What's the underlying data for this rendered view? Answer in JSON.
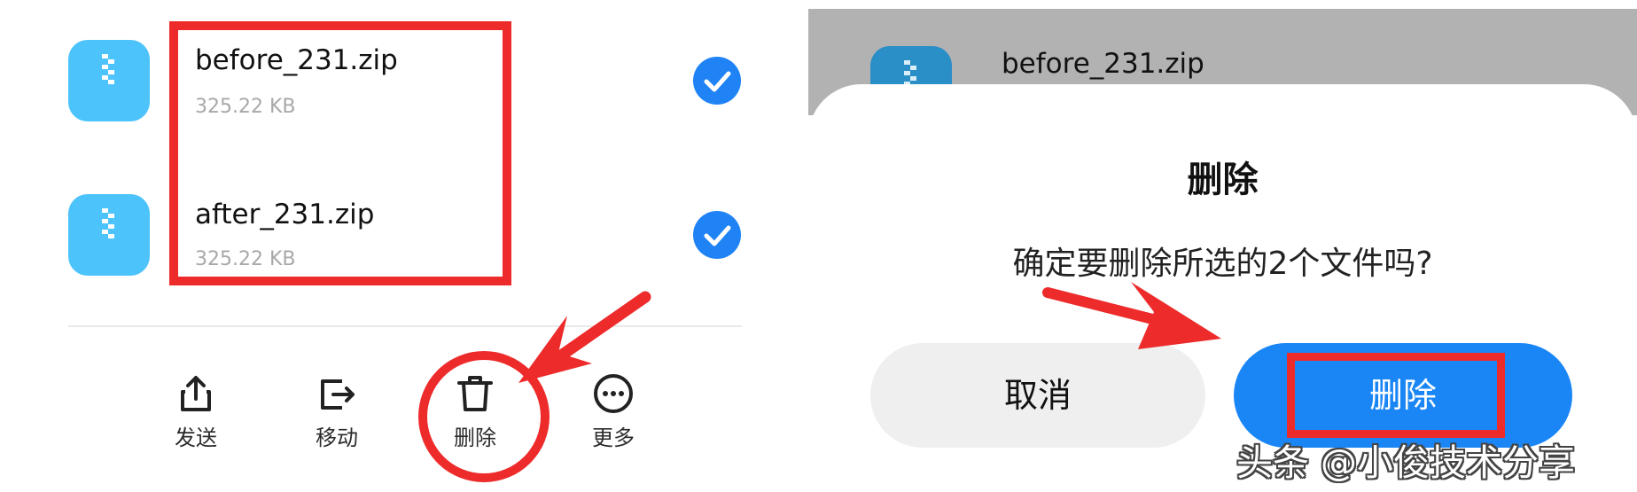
{
  "left_panel": {
    "files": [
      {
        "name": "before_231.zip",
        "size": "325.22 KB",
        "checked": true
      },
      {
        "name": "after_231.zip",
        "size": "325.22 KB",
        "checked": true
      }
    ],
    "toolbar": [
      {
        "label": "发送",
        "icon": "share-icon"
      },
      {
        "label": "移动",
        "icon": "move-icon"
      },
      {
        "label": "删除",
        "icon": "trash-icon"
      },
      {
        "label": "更多",
        "icon": "more-icon"
      }
    ]
  },
  "right_panel": {
    "background_file": {
      "name": "before_231.zip"
    },
    "dialog": {
      "title": "删除",
      "message": "确定要删除所选的2个文件吗?",
      "cancel_label": "取消",
      "confirm_label": "删除"
    },
    "watermark": "头条 @小俊技术分享"
  },
  "colors": {
    "accent_blue": "#1a86f6",
    "zip_icon": "#4cc3fb",
    "annotation_red": "#ee2b2b",
    "dim_overlay": "#b2b2b2"
  }
}
